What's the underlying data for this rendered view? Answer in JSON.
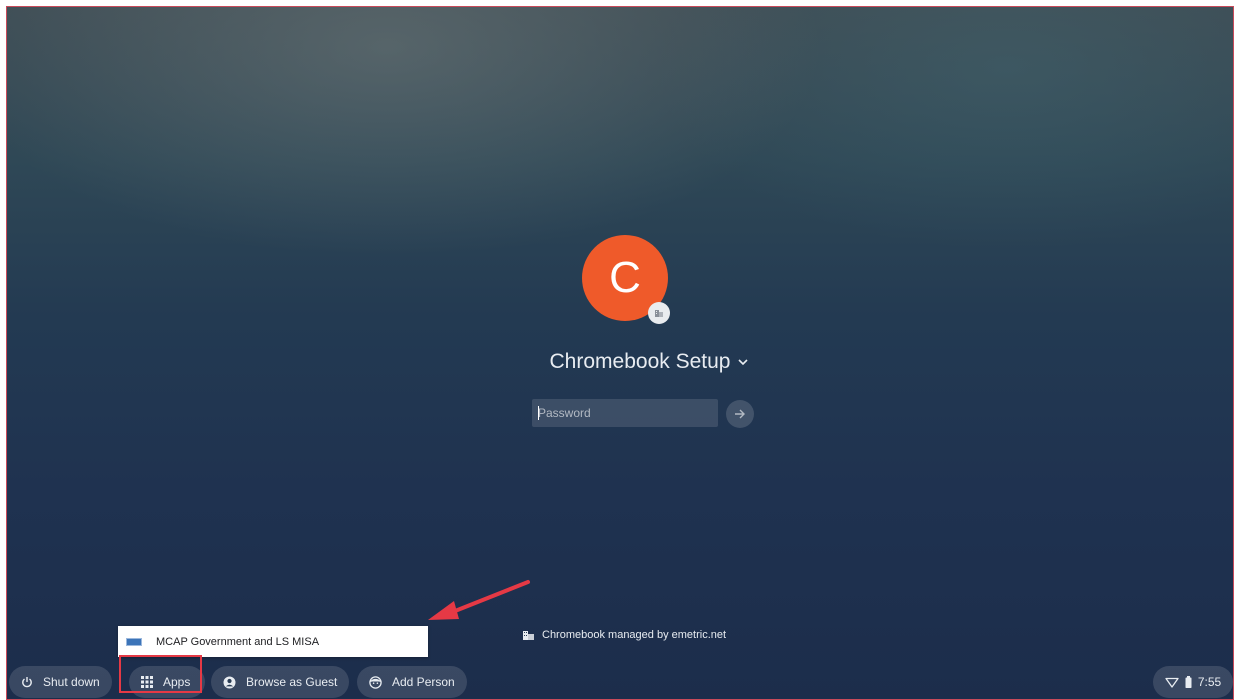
{
  "login": {
    "avatar_letter": "C",
    "avatar_color": "#ef5a2a",
    "user_name": "Chromebook Setup",
    "password_placeholder": "Password"
  },
  "management": {
    "text": "Chromebook managed by emetric.net"
  },
  "apps_menu": {
    "items": [
      {
        "label": "MCAP Government and LS MISA",
        "icon": "app-logo-icon"
      }
    ]
  },
  "shelf": {
    "shutdown_label": "Shut down",
    "apps_label": "Apps",
    "guest_label": "Browse as Guest",
    "add_person_label": "Add Person"
  },
  "status": {
    "time": "7:55",
    "icons": [
      "wifi-icon",
      "battery-icon"
    ]
  },
  "annotation": {
    "highlight_color": "#e53945",
    "arrow_color": "#e53945"
  }
}
